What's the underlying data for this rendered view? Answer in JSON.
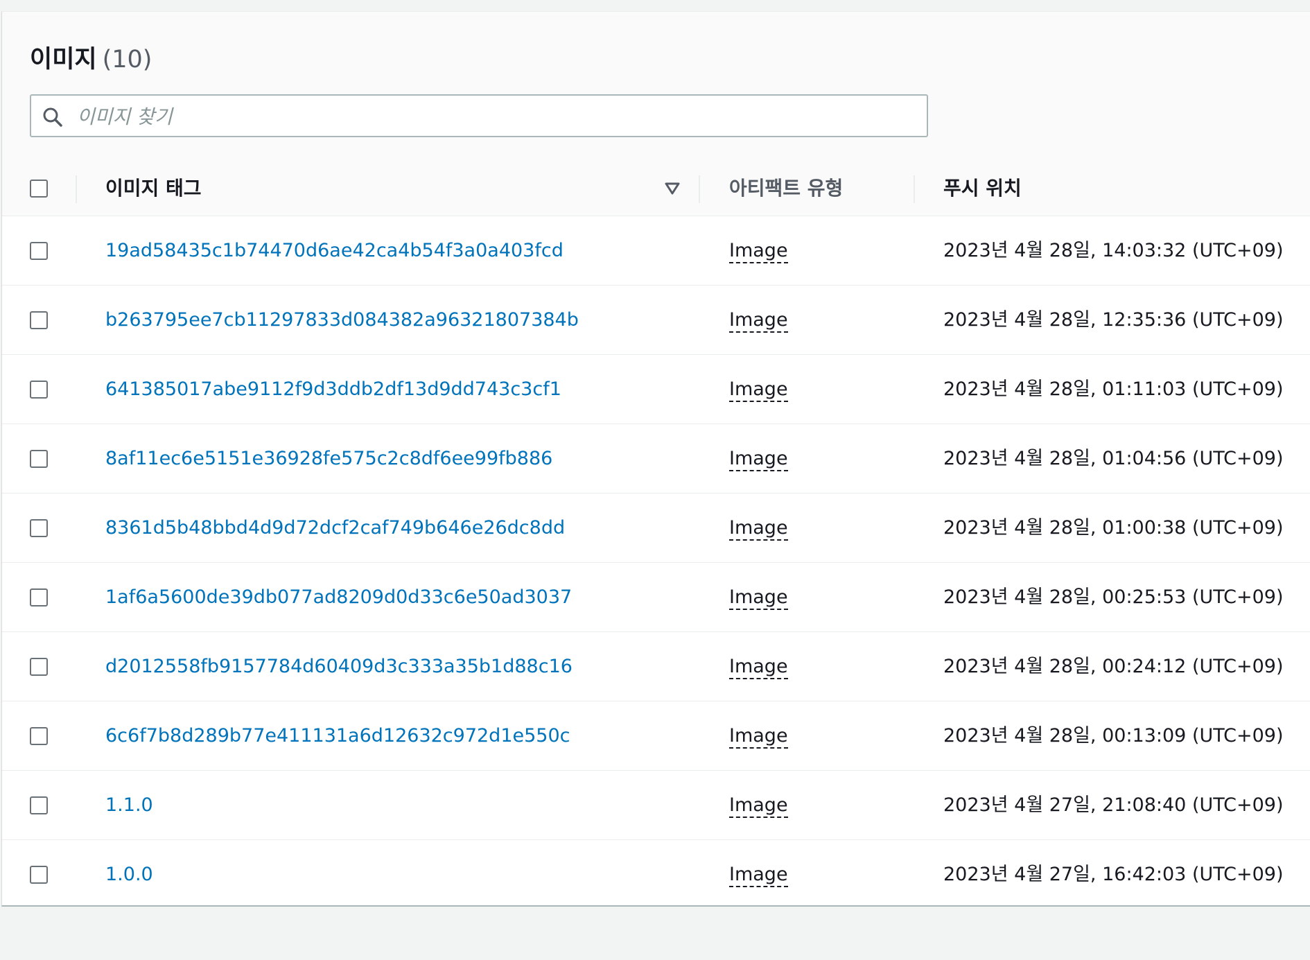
{
  "header": {
    "title": "이미지",
    "count": "(10)"
  },
  "search": {
    "placeholder": "이미지 찾기",
    "value": ""
  },
  "columns": {
    "tag": "이미지 태그",
    "artifact": "아티팩트 유형",
    "pushed": "푸시 위치"
  },
  "rows": [
    {
      "tag": "19ad58435c1b74470d6ae42ca4b54f3a0a403fcd",
      "artifact": "Image",
      "pushed": "2023년 4월 28일, 14:03:32 (UTC+09)"
    },
    {
      "tag": "b263795ee7cb11297833d084382a96321807384b",
      "artifact": "Image",
      "pushed": "2023년 4월 28일, 12:35:36 (UTC+09)"
    },
    {
      "tag": "641385017abe9112f9d3ddb2df13d9dd743c3cf1",
      "artifact": "Image",
      "pushed": "2023년 4월 28일, 01:11:03 (UTC+09)"
    },
    {
      "tag": "8af11ec6e5151e36928fe575c2c8df6ee99fb886",
      "artifact": "Image",
      "pushed": "2023년 4월 28일, 01:04:56 (UTC+09)"
    },
    {
      "tag": "8361d5b48bbd4d9d72dcf2caf749b646e26dc8dd",
      "artifact": "Image",
      "pushed": "2023년 4월 28일, 01:00:38 (UTC+09)"
    },
    {
      "tag": "1af6a5600de39db077ad8209d0d33c6e50ad3037",
      "artifact": "Image",
      "pushed": "2023년 4월 28일, 00:25:53 (UTC+09)"
    },
    {
      "tag": "d2012558fb9157784d60409d3c333a35b1d88c16",
      "artifact": "Image",
      "pushed": "2023년 4월 28일, 00:24:12 (UTC+09)"
    },
    {
      "tag": "6c6f7b8d289b77e411131a6d12632c972d1e550c",
      "artifact": "Image",
      "pushed": "2023년 4월 28일, 00:13:09 (UTC+09)"
    },
    {
      "tag": "1.1.0",
      "artifact": "Image",
      "pushed": "2023년 4월 27일, 21:08:40 (UTC+09)"
    },
    {
      "tag": "1.0.0",
      "artifact": "Image",
      "pushed": "2023년 4월 27일, 16:42:03 (UTC+09)"
    }
  ],
  "icons": {
    "search": "search-icon",
    "sort": "sort-descending-icon"
  },
  "colors": {
    "link": "#0073bb",
    "text": "#16191f",
    "muted": "#545b64",
    "border": "#aab7b8"
  }
}
